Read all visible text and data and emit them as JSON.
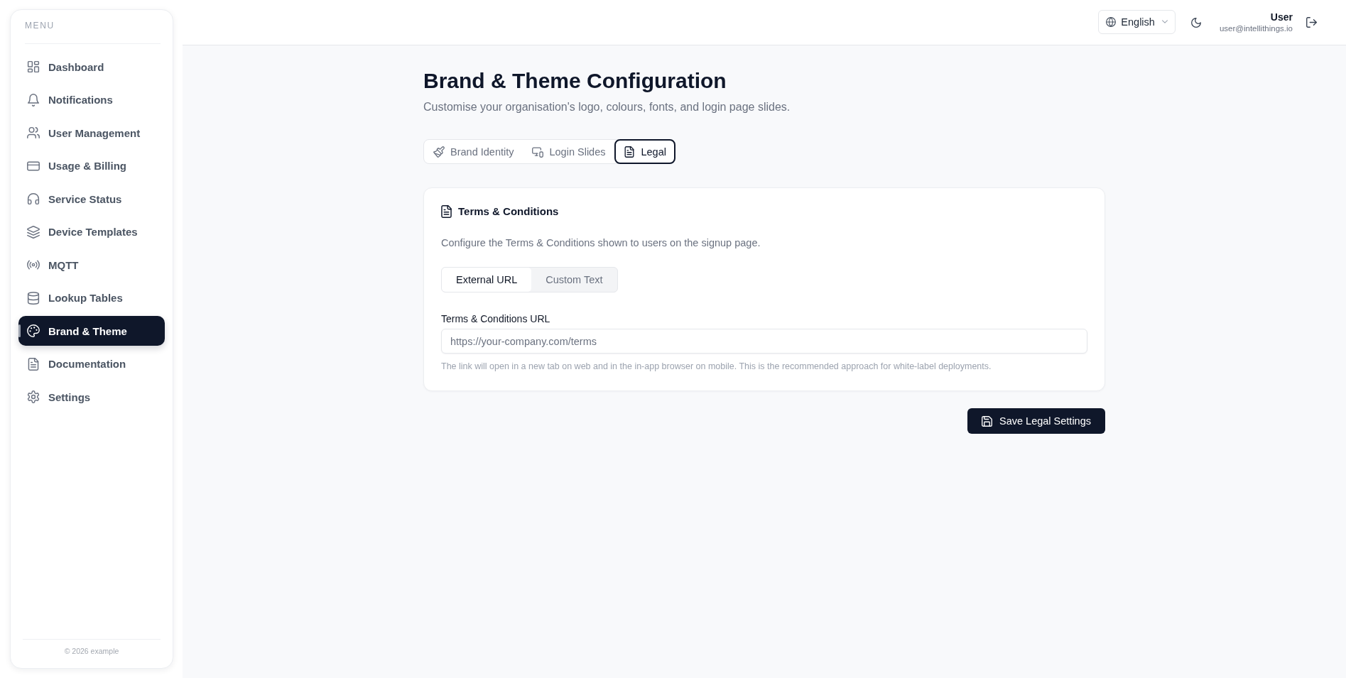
{
  "sidebar": {
    "heading": "MENU",
    "items": [
      {
        "label": "Dashboard",
        "selected": false
      },
      {
        "label": "Notifications",
        "selected": false
      },
      {
        "label": "User Management",
        "selected": false
      },
      {
        "label": "Usage & Billing",
        "selected": false
      },
      {
        "label": "Service Status",
        "selected": false
      },
      {
        "label": "Device Templates",
        "selected": false
      },
      {
        "label": "MQTT",
        "selected": false
      },
      {
        "label": "Lookup Tables",
        "selected": false
      },
      {
        "label": "Brand & Theme",
        "selected": true
      },
      {
        "label": "Documentation",
        "selected": false
      },
      {
        "label": "Settings",
        "selected": false
      }
    ],
    "footer": "© 2026 example"
  },
  "header": {
    "language": "English",
    "user_name": "User",
    "user_email": "user@intellithings.io"
  },
  "page": {
    "title": "Brand & Theme Configuration",
    "subtitle": "Customise your organisation's logo, colours, fonts, and login page slides."
  },
  "tabs": [
    {
      "label": "Brand Identity",
      "selected": false
    },
    {
      "label": "Login Slides",
      "selected": false
    },
    {
      "label": "Legal",
      "selected": true
    }
  ],
  "terms_card": {
    "title": "Terms & Conditions",
    "description": "Configure the Terms & Conditions shown to users on the signup page.",
    "modes": [
      {
        "label": "External URL",
        "selected": true
      },
      {
        "label": "Custom Text",
        "selected": false
      }
    ],
    "url_field": {
      "label": "Terms & Conditions URL",
      "placeholder": "https://your-company.com/terms"
    },
    "hint": "The link will open in a new tab on web and in the in-app browser on mobile. This is the recommended approach for white-label deployments."
  },
  "save_button": {
    "label": "Save Legal Settings"
  }
}
